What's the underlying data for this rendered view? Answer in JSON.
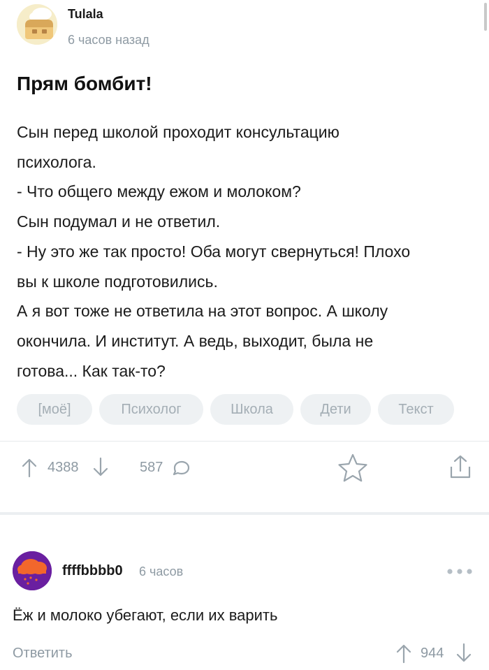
{
  "post": {
    "author": "Tulala",
    "time": "6 часов назад",
    "title": "Прям бомбит!",
    "body_lines": [
      "Сын перед школой проходит консультацию",
      "психолога.",
      "- Что общего между ежом и молоком?",
      "Сын подумал и не ответил.",
      "- Ну это же так просто! Оба могут свернуться! Плохо",
      "вы к школе подготовились.",
      "А я вот тоже не ответила на этот вопрос. А школу",
      "окончила. И институт. А ведь, выходит, была  не",
      "готова... Как так-то?"
    ],
    "tags": [
      "[моё]",
      "Психолог",
      "Школа",
      "Дети",
      "Текст"
    ],
    "rating": "4388",
    "comments_count": "587"
  },
  "comment": {
    "author": "ffffbbbb0",
    "time": "6 часов",
    "text": "Ёж и молоко убегают, если их варить",
    "reply_label": "Ответить",
    "rating": "944"
  },
  "colors": {
    "muted": "#8e9aa3",
    "tag_bg": "#eef1f3",
    "comment_avatar": "#6a1fa0"
  }
}
